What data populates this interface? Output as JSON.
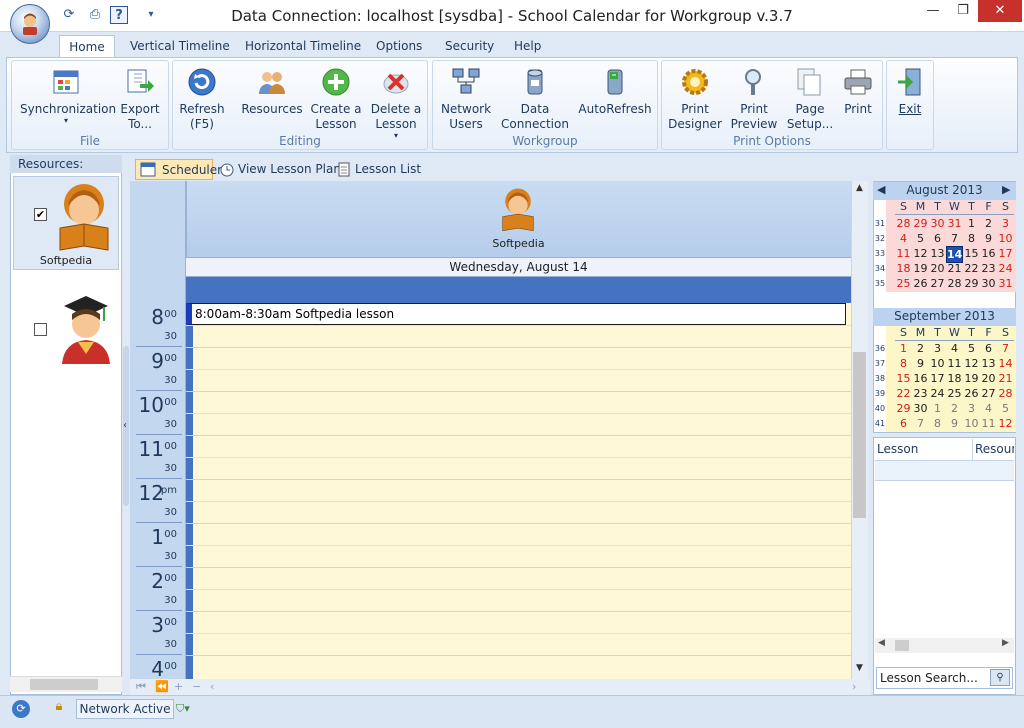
{
  "window": {
    "title": "Data Connection: localhost [sysdba] - School Calendar for Workgroup v.3.7"
  },
  "ribbon_tabs": [
    "Home",
    "Vertical Timeline",
    "Horizontal Timeline",
    "Options",
    "Security",
    "Help"
  ],
  "groups": {
    "file": {
      "label": "File",
      "sync": "Synchronization",
      "export1": "Export",
      "export2": "To..."
    },
    "editing": {
      "label": "Editing",
      "refresh1": "Refresh",
      "refresh2": "(F5)",
      "resources": "Resources",
      "create1": "Create a",
      "create2": "Lesson",
      "delete1": "Delete a",
      "delete2": "Lesson"
    },
    "workgroup": {
      "label": "Workgroup",
      "net1": "Network",
      "net2": "Users",
      "data1": "Data",
      "data2": "Connection",
      "autorefresh": "AutoRefresh"
    },
    "print": {
      "label": "Print Options",
      "designer1": "Print",
      "designer2": "Designer",
      "preview1": "Print",
      "preview2": "Preview",
      "setup1": "Page",
      "setup2": "Setup...",
      "print": "Print"
    },
    "exit": {
      "label": "Exit"
    }
  },
  "resources": {
    "header": "Resources:",
    "items": [
      {
        "name": "Softpedia",
        "checked": "✔"
      },
      {
        "name": "",
        "checked": ""
      }
    ]
  },
  "view_tabs": {
    "scheduler": "Scheduler",
    "lesson_plans": "View Lesson Plans",
    "lesson_list": "Lesson List"
  },
  "schedule": {
    "resource_name": "Softpedia",
    "day_label": "Wednesday, August 14",
    "hours": [
      {
        "h": "8",
        "m": "00",
        "half": "30"
      },
      {
        "h": "9",
        "m": "00",
        "half": "30"
      },
      {
        "h": "10",
        "m": "00",
        "half": "30"
      },
      {
        "h": "11",
        "m": "00",
        "half": "30"
      },
      {
        "h": "12",
        "m": "pm",
        "half": "30"
      },
      {
        "h": "1",
        "m": "00",
        "half": "30"
      },
      {
        "h": "2",
        "m": "00",
        "half": "30"
      },
      {
        "h": "3",
        "m": "00",
        "half": "30"
      },
      {
        "h": "4",
        "m": "00",
        "half": ""
      }
    ],
    "appointment": "8:00am-8:30am Softpedia lesson"
  },
  "calendar": {
    "dow": [
      "S",
      "M",
      "T",
      "W",
      "T",
      "F",
      "S"
    ],
    "aug": {
      "title": "August 2013",
      "weeks": [
        "31",
        "32",
        "33",
        "34",
        "35"
      ],
      "days": [
        [
          "28",
          "29",
          "30",
          "31",
          "1",
          "2",
          "3"
        ],
        [
          "4",
          "5",
          "6",
          "7",
          "8",
          "9",
          "10"
        ],
        [
          "11",
          "12",
          "13",
          "14",
          "15",
          "16",
          "17"
        ],
        [
          "18",
          "19",
          "20",
          "21",
          "22",
          "23",
          "24"
        ],
        [
          "25",
          "26",
          "27",
          "28",
          "29",
          "30",
          "31"
        ]
      ],
      "selected": "14"
    },
    "sep": {
      "title": "September 2013",
      "weeks": [
        "36",
        "37",
        "38",
        "39",
        "40",
        "41"
      ],
      "days": [
        [
          "1",
          "2",
          "3",
          "4",
          "5",
          "6",
          "7"
        ],
        [
          "8",
          "9",
          "10",
          "11",
          "12",
          "13",
          "14"
        ],
        [
          "15",
          "16",
          "17",
          "18",
          "19",
          "20",
          "21"
        ],
        [
          "22",
          "23",
          "24",
          "25",
          "26",
          "27",
          "28"
        ],
        [
          "29",
          "30",
          "1",
          "2",
          "3",
          "4",
          "5"
        ],
        [
          "6",
          "7",
          "8",
          "9",
          "10",
          "11",
          "12"
        ]
      ]
    }
  },
  "lesson_list": {
    "col_lesson": "Lesson",
    "col_resource": "Resource",
    "search": "Lesson Search..."
  },
  "status": {
    "text": "Network Active"
  },
  "colors": {
    "accent": "#4672c2",
    "grid": "#fff8d7",
    "appointment_bar": "#1a3cbd",
    "close": "#c7312b"
  }
}
